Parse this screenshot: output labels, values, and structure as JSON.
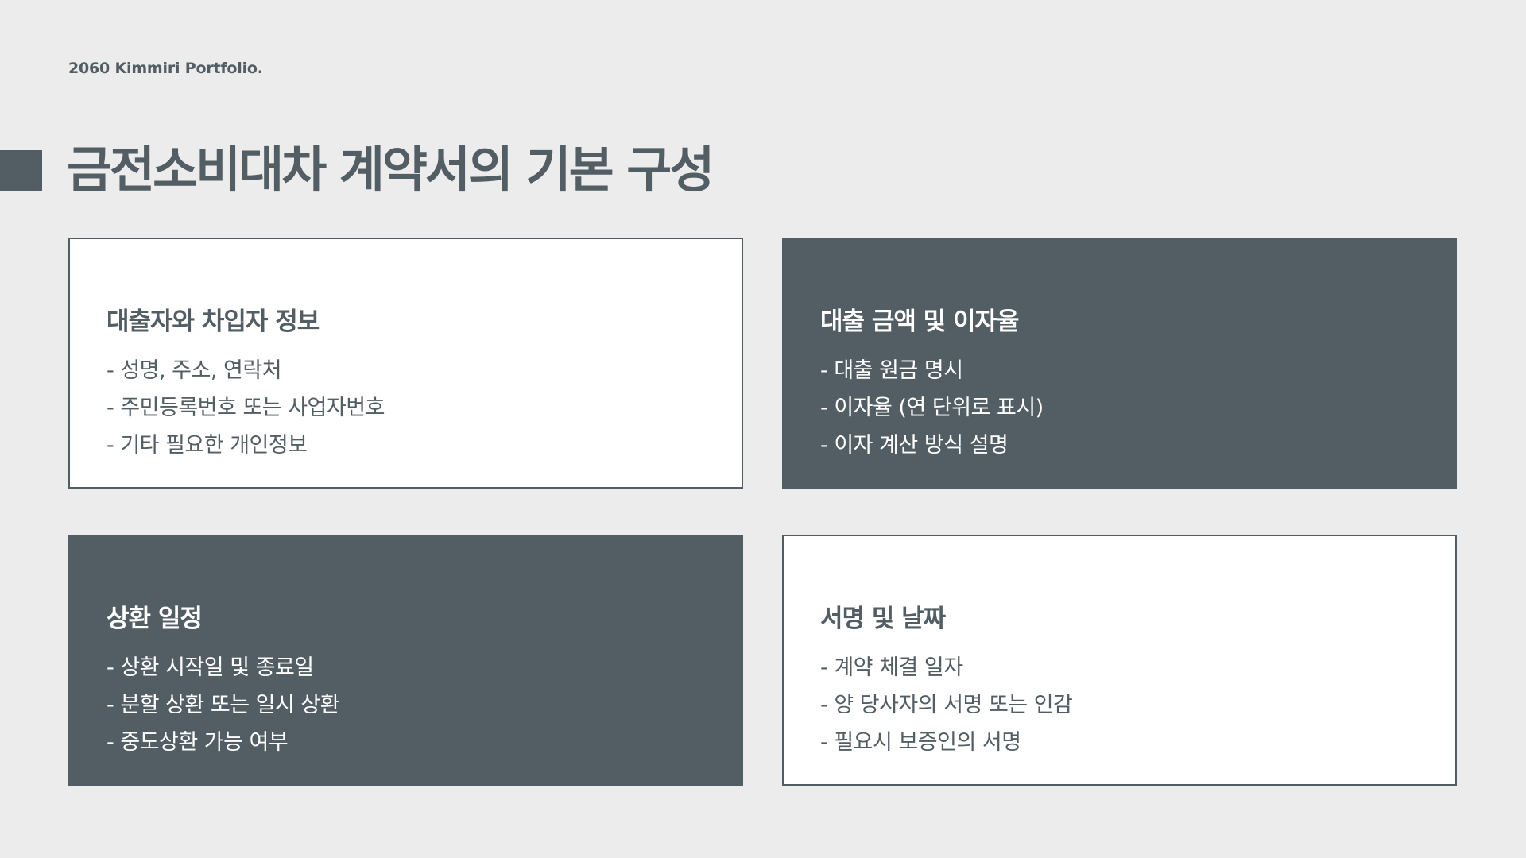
{
  "header": {
    "brand": "2060 Kimmiri Portfolio.",
    "title": "금전소비대차 계약서의 기본 구성"
  },
  "cards": [
    {
      "heading": "대출자와 차입자 정보",
      "items": [
        "- 성명, 주소, 연락처",
        "- 주민등록번호 또는 사업자번호",
        "- 기타 필요한 개인정보"
      ]
    },
    {
      "heading": "대출 금액 및 이자율",
      "items": [
        "- 대출 원금 명시",
        "- 이자율 (연 단위로 표시)",
        "- 이자 계산 방식 설명"
      ]
    },
    {
      "heading": "상환 일정",
      "items": [
        "- 상환 시작일 및 종료일",
        "- 분할 상환 또는 일시 상환",
        "- 중도상환 가능 여부"
      ]
    },
    {
      "heading": "서명 및 날짜",
      "items": [
        "- 계약 체결 일자",
        "- 양 당사자의 서명 또는 인감",
        "- 필요시 보증인의 서명"
      ]
    }
  ],
  "colors": {
    "background": "#ececec",
    "accent": "#525e64",
    "card_light": "#ffffff"
  }
}
